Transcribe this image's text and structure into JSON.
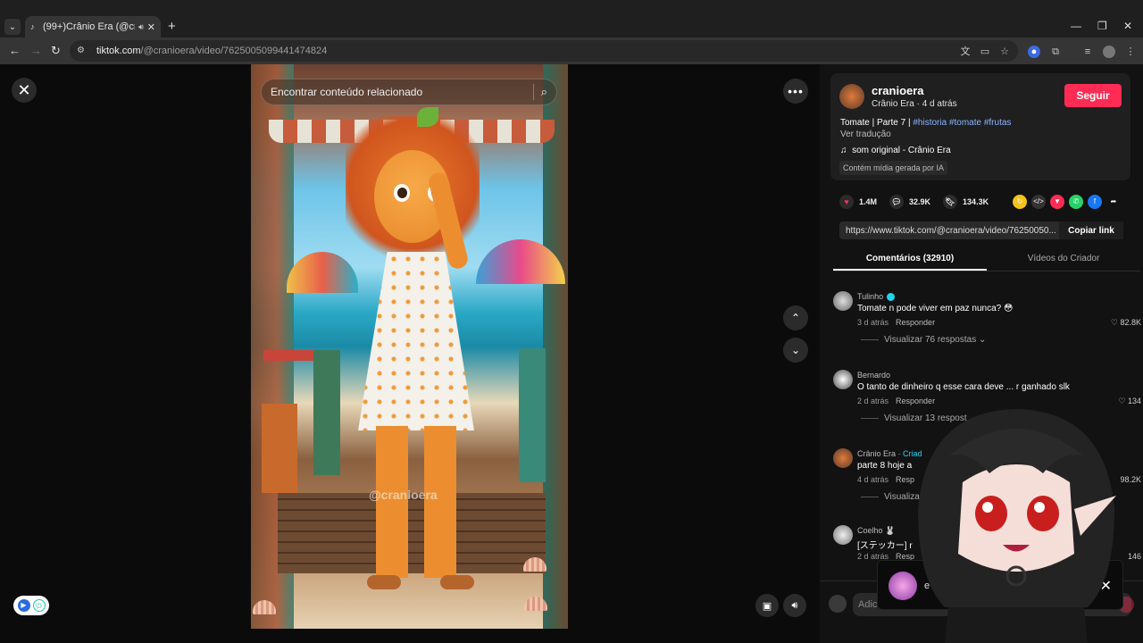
{
  "browser": {
    "tab_title": "(99+)Crânio Era (@cranioera",
    "url_domain": "tiktok.com",
    "url_path": "/@cranioera/video/7625005099441474824"
  },
  "video": {
    "search_placeholder": "Encontrar conteúdo relacionado",
    "watermark": "@cranioera"
  },
  "creator": {
    "handle": "cranioera",
    "display_name": "Crânio Era",
    "time_ago": "4 d atrás",
    "follow_label": "Seguir"
  },
  "description": {
    "caption_text": "Tomate | Parte 7 |",
    "hashtags": "#historia #tomate #frutas",
    "translate_label": "Ver tradução",
    "music": "som original - Crânio Era",
    "ai_badge": "Contém mídia gerada por IA"
  },
  "stats": {
    "likes": "1.4M",
    "comments": "32.9K",
    "saves": "134.3K"
  },
  "share": {
    "link": "https://www.tiktok.com/@cranioera/video/76250050...",
    "copy_label": "Copiar link"
  },
  "tabs": {
    "comments": "Comentários (32910)",
    "creator_videos": "Vídeos do Criador"
  },
  "comments": [
    {
      "name": "Tulinho",
      "text": "Tomate n pode viver em paz nunca? 😳",
      "time": "3 d atrás",
      "reply": "Responder",
      "likes": "82.8K",
      "replies": "Visualizar 76 respostas ⌄"
    },
    {
      "name": "Bernardo",
      "text": "O tanto de dinheiro q esse cara deve ... r ganhado slk",
      "time": "2 d atrás",
      "reply": "Responder",
      "likes": "134",
      "replies": "Visualizar 13 respost"
    },
    {
      "name": "Crânio Era · ",
      "creator_tag": "Criad",
      "text": "parte 8 hoje a",
      "time": "4 d atrás",
      "reply": "Resp",
      "likes": "98.2K",
      "replies": "Visualizar"
    },
    {
      "name": "Coelho 🐰",
      "text": "[ステッカー] r",
      "time": "2 d atrás",
      "reply": "Resp",
      "likes": "146",
      "replies": ""
    }
  ],
  "add_comment_placeholder": "Adic",
  "notification": {
    "text": "e"
  },
  "colors": {
    "accent": "#fe2c55",
    "hashtag": "#8ab4ff",
    "verified": "#20d5ec"
  }
}
